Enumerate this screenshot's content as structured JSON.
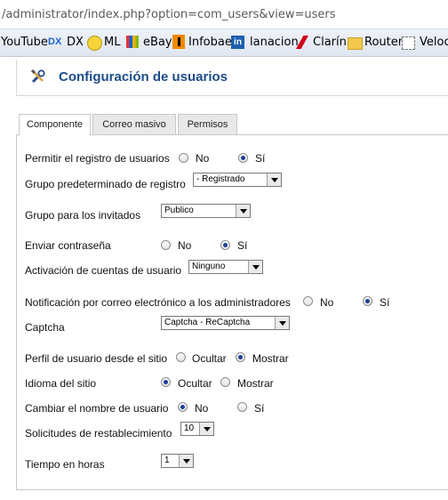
{
  "address": {
    "url": "/administrator/index.php?option=com_users&view=users"
  },
  "bookmarks": [
    {
      "label": "YouTube",
      "icon": "youtube-icon"
    },
    {
      "label": "DX",
      "icon": "dx-icon"
    },
    {
      "label": "ML",
      "icon": "mercadolibre-icon"
    },
    {
      "label": "eBay",
      "icon": "ebay-icon"
    },
    {
      "label": "Infobae",
      "icon": "infobae-icon"
    },
    {
      "label": "lanacion",
      "icon": "linkedin-icon"
    },
    {
      "label": "Clarín",
      "icon": "clarin-icon"
    },
    {
      "label": "Router",
      "icon": "folder-icon"
    },
    {
      "label": "Veloci",
      "icon": "page-icon"
    }
  ],
  "header": {
    "title": "Configuración de usuarios",
    "icon": "tools-icon"
  },
  "tabs": [
    {
      "label": "Componente",
      "active": true
    },
    {
      "label": "Correo masivo",
      "active": false
    },
    {
      "label": "Permisos",
      "active": false
    }
  ],
  "form": {
    "registro": {
      "label": "Permitir el registro de usuarios",
      "opt_no": "No",
      "opt_si": "Sí",
      "selected": "Sí"
    },
    "grupo_registro": {
      "label": "Grupo predeterminado de registro",
      "value": "- Registrado"
    },
    "grupo_invitados": {
      "label": "Grupo para los invitados",
      "value": "Publico"
    },
    "enviar_contrasena": {
      "label": "Enviar contraseña",
      "opt_no": "No",
      "opt_si": "Sí",
      "selected": "Sí"
    },
    "activacion": {
      "label": "Activación de cuentas de usuario",
      "value": "Ninguno"
    },
    "notificacion": {
      "label": "Notificación por correo electrónico a los administradores",
      "opt_no": "No",
      "opt_si": "Sí",
      "selected": "Sí"
    },
    "captcha": {
      "label": "Captcha",
      "value": "Captcha - ReCaptcha"
    },
    "perfil": {
      "label": "Perfil de usuario desde el sitio",
      "opt_a": "Ocultar",
      "opt_b": "Mostrar",
      "selected": "Mostrar"
    },
    "idioma": {
      "label": "Idioma del sitio",
      "opt_a": "Ocultar",
      "opt_b": "Mostrar",
      "selected": "Ocultar"
    },
    "cambiar_nombre": {
      "label": "Cambiar el nombre de usuario",
      "opt_no": "No",
      "opt_si": "Sí",
      "selected": "No"
    },
    "solicitudes": {
      "label": "Solicitudes de restablecimiento",
      "value": "10"
    },
    "tiempo": {
      "label": "Tiempo en horas",
      "value": "1"
    }
  },
  "colors": {
    "title": "#1d4e87",
    "radio_dot": "#1c3f94"
  }
}
